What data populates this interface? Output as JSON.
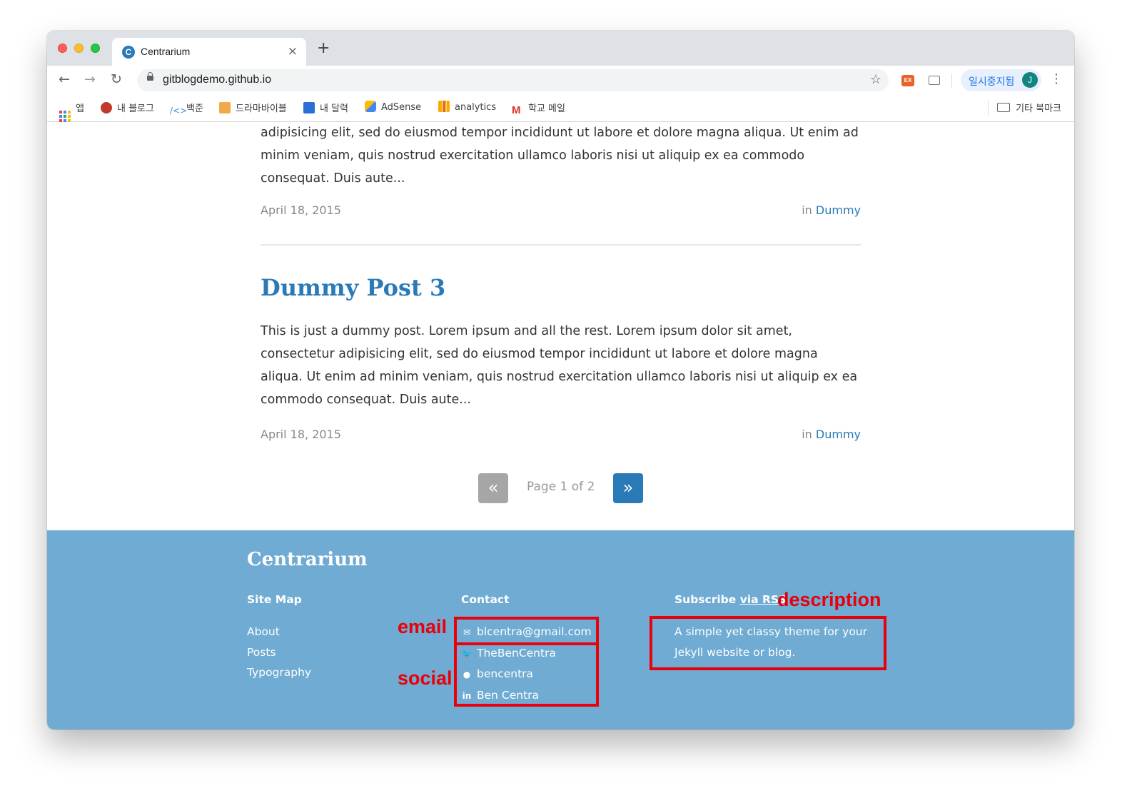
{
  "browser": {
    "tab_title": "Centrarium",
    "tab_favicon_letter": "C",
    "tab_close": "×",
    "new_tab": "+",
    "url": "gitblogdemo.github.io",
    "profile_label": "일시중지됨",
    "profile_initial": "J",
    "extension_label": "EX",
    "back": "←",
    "forward": "→",
    "reload": "↻",
    "star": "☆",
    "menu": "⋮",
    "bookmarks": [
      {
        "label": "앱",
        "icon": "apps-grid-icon"
      },
      {
        "label": "내 블로그",
        "icon": "blog-icon"
      },
      {
        "label": "백준",
        "icon": "code-icon"
      },
      {
        "label": "드라마바이블",
        "icon": "bookmark-icon"
      },
      {
        "label": "내 달력",
        "icon": "calendar-icon"
      },
      {
        "label": "AdSense",
        "icon": "adsense-icon"
      },
      {
        "label": "analytics",
        "icon": "analytics-icon"
      },
      {
        "label": "학교 메일",
        "icon": "gmail-icon"
      }
    ],
    "other_bookmarks": "기타 북마크"
  },
  "posts": {
    "prev_excerpt": "adipisicing elit, sed do eiusmod tempor incididunt ut labore et dolore magna aliqua. Ut enim ad minim veniam, quis nostrud exercitation ullamco laboris nisi ut aliquip ex ea commodo consequat. Duis aute...",
    "prev_date": "April 18, 2015",
    "prev_category_prefix": "in",
    "prev_category": "Dummy",
    "post3_title": "Dummy Post 3",
    "post3_excerpt": "This is just a dummy post. Lorem ipsum and all the rest. Lorem ipsum dolor sit amet, consectetur adipisicing elit, sed do eiusmod tempor incididunt ut labore et dolore magna aliqua. Ut enim ad minim veniam, quis nostrud exercitation ullamco laboris nisi ut aliquip ex ea commodo consequat. Duis aute...",
    "post3_date": "April 18, 2015",
    "post3_category_prefix": "in",
    "post3_category": "Dummy"
  },
  "pagination": {
    "prev_icon": "«",
    "next_icon": "»",
    "label": "Page 1 of 2"
  },
  "footer": {
    "site_title": "Centrarium",
    "sitemap_heading": "Site Map",
    "sitemap_links": [
      "About",
      "Posts",
      "Typography"
    ],
    "contact_heading": "Contact",
    "email": "blcentra@gmail.com",
    "twitter": "TheBenCentra",
    "github": "bencentra",
    "linkedin": "Ben Centra",
    "subscribe_heading": "Subscribe",
    "rss_link": "via RSS",
    "description": "A simple yet classy theme for your Jekyll website or blog."
  },
  "annotations": {
    "email_label": "email",
    "social_label": "social",
    "description_label": "description",
    "color": "#e8000a"
  },
  "colors": {
    "accent": "#2a7ab8",
    "footer_bg": "#6fabd2",
    "pager_disabled": "#a6a6a6"
  }
}
